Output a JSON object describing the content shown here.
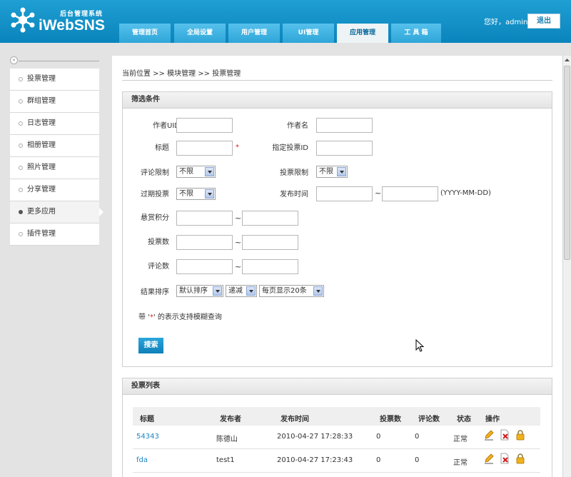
{
  "header": {
    "logo_subtitle": "后台管理系统",
    "logo_title": "iWebSNS",
    "greeting": "您好，admin",
    "logout_label": "退出",
    "nav": [
      "管理首页",
      "全局设置",
      "用户管理",
      "UI管理",
      "应用管理",
      "工 具 箱"
    ],
    "active_nav": "应用管理"
  },
  "sidebar": {
    "items": [
      "投票管理",
      "群组管理",
      "日志管理",
      "相册管理",
      "照片管理",
      "分享管理",
      "更多应用",
      "插件管理"
    ],
    "active_item": "更多应用"
  },
  "breadcrumb": "当前位置 >> 模块管理 >> 投票管理",
  "filter": {
    "title": "筛选条件",
    "labels": {
      "author_uid": "作者UID",
      "author_name": "作者名",
      "title": "标题",
      "poll_id": "指定投票ID",
      "comment_limit": "评论限制",
      "vote_limit": "投票限制",
      "expired": "过期投票",
      "publish_time": "发布时间",
      "reward_points": "悬赏积分",
      "vote_count": "投票数",
      "comment_count": "评论数",
      "sort": "结果排序"
    },
    "required_mark": "*",
    "selects": {
      "comment_limit": "不限",
      "vote_limit": "不限",
      "expired": "不限",
      "sort_field": "默认排序",
      "sort_order": "递减",
      "page_size": "每页显示20条"
    },
    "range_sep": "~",
    "date_format": "(YYYY-MM-DD)",
    "fuzzy_note": {
      "before": "带 '",
      "mark": "*",
      "after": "' 的表示支持模糊查询"
    },
    "search_label": "搜索"
  },
  "list": {
    "title": "投票列表",
    "columns": [
      "标题",
      "发布者",
      "发布时间",
      "投票数",
      "评论数",
      "状态",
      "操作"
    ],
    "rows": [
      {
        "title": "54343",
        "author": "陈德山",
        "time": "2010-04-27 17:28:33",
        "votes": "0",
        "comments": "0",
        "status": "正常"
      },
      {
        "title": "fda",
        "author": "test1",
        "time": "2010-04-27 17:23:43",
        "votes": "0",
        "comments": "0",
        "status": "正常"
      }
    ]
  },
  "colors": {
    "header": "#0a84bc",
    "accent": "#1d86c4",
    "required": "#e02020"
  }
}
